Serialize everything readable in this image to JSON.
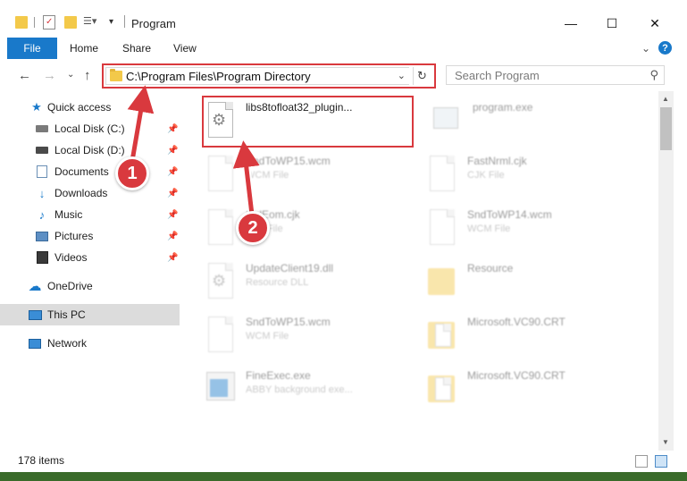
{
  "window": {
    "title": "Program"
  },
  "window_controls": {
    "minimize": "—",
    "maximize": "☐",
    "close": "✕"
  },
  "ribbon": {
    "file": "File",
    "tabs": [
      "Home",
      "Share",
      "View"
    ],
    "help": "?"
  },
  "address_bar": {
    "path": "C:\\Program Files\\Program Directory"
  },
  "search": {
    "placeholder": "Search Program"
  },
  "sidebar": {
    "quick_access": "Quick access",
    "items": [
      {
        "label": "Local Disk (C:)",
        "icon": "drive-icon"
      },
      {
        "label": "Local Disk (D:)",
        "icon": "drive-icon"
      },
      {
        "label": "Documents",
        "icon": "documents-icon"
      },
      {
        "label": "Downloads",
        "icon": "downloads-icon"
      },
      {
        "label": "Music",
        "icon": "music-icon"
      },
      {
        "label": "Pictures",
        "icon": "pictures-icon"
      },
      {
        "label": "Videos",
        "icon": "videos-icon"
      }
    ],
    "onedrive": "OneDrive",
    "this_pc": "This PC",
    "network": "Network"
  },
  "files": [
    {
      "name": "libs8tofloat32_plugin...",
      "sub": "",
      "kind": "dll-highlighted"
    },
    {
      "name": "program.exe",
      "sub": "",
      "kind": "exe"
    },
    {
      "name": "SndToWP15.wcm",
      "sub": "WCM File",
      "kind": "doc"
    },
    {
      "name": "FastNrml.cjk",
      "sub": "CJK File",
      "kind": "doc"
    },
    {
      "name": "StdEom.cjk",
      "sub": "CJK File",
      "kind": "doc"
    },
    {
      "name": "SndToWP14.wcm",
      "sub": "WCM File",
      "kind": "doc"
    },
    {
      "name": "UpdateClient19.dll",
      "sub": "Resource DLL",
      "kind": "dll"
    },
    {
      "name": "Resource",
      "sub": "",
      "kind": "folder"
    },
    {
      "name": "SndToWP15.wcm",
      "sub": "WCM File",
      "kind": "doc"
    },
    {
      "name": "Microsoft.VC90.CRT",
      "sub": "",
      "kind": "folder-doc"
    },
    {
      "name": "FineExec.exe",
      "sub": "ABBY background exe...",
      "kind": "exe"
    },
    {
      "name": "Microsoft.VC90.CRT",
      "sub": "",
      "kind": "folder-doc"
    }
  ],
  "status": {
    "item_count": "178 items"
  },
  "callouts": [
    "1",
    "2"
  ],
  "colors": {
    "accent": "#1979ca",
    "highlight_red": "#d9393e",
    "folder_yellow": "#f3c94a"
  }
}
